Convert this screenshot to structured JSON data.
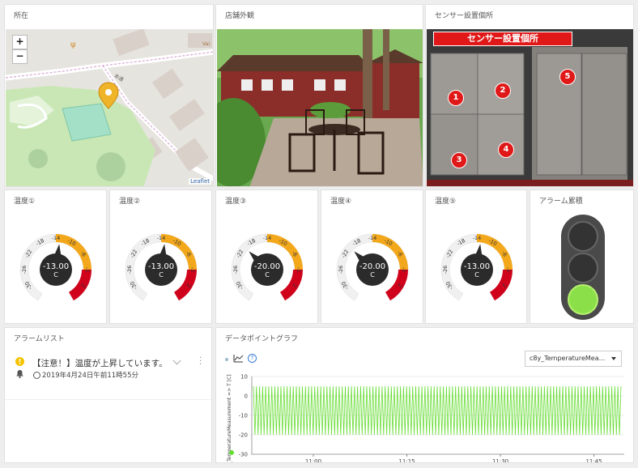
{
  "map": {
    "title": "所在",
    "zoom_in": "+",
    "zoom_out": "−",
    "street_label": "本通",
    "edge_label": "Vai",
    "attribution": "Leaflet"
  },
  "store": {
    "title": "店舗外観"
  },
  "sensor": {
    "title": "センサー設置個所",
    "banner": "センサー設置個所",
    "markers": [
      "1",
      "2",
      "3",
      "4",
      "5"
    ]
  },
  "gauges": [
    {
      "title": "温度①",
      "value": "-13.00",
      "unit": "C",
      "reading": -13
    },
    {
      "title": "温度②",
      "value": "-13.00",
      "unit": "C",
      "reading": -13
    },
    {
      "title": "温度③",
      "value": "-20.00",
      "unit": "C",
      "reading": -20
    },
    {
      "title": "温度④",
      "value": "-20.00",
      "unit": "C",
      "reading": -20
    },
    {
      "title": "温度⑤",
      "value": "-13.00",
      "unit": "C",
      "reading": -13
    }
  ],
  "gauge_ticks": [
    "-30",
    "-26",
    "-22",
    "-18",
    "-14",
    "-10",
    "-6",
    "-2",
    "2"
  ],
  "gauge_colors": {
    "green": "#ffffff",
    "yellow": "#f3a81c",
    "red": "#d0021b",
    "dial": "#2b2b2b"
  },
  "alarm_light": {
    "title": "アラーム累積",
    "active": "green"
  },
  "alarm_list": {
    "title": "アラームリスト",
    "items": [
      {
        "message": "【注意！】温度が上昇しています。",
        "time": "2019年4月24日午前11時55分"
      }
    ]
  },
  "datapoint": {
    "title": "データポイントグラフ",
    "select_value": "c8y_TemperatureMea...",
    "ylabel": "c8y_TemperatureMeasurement => T [C]"
  },
  "chart_data": {
    "type": "line",
    "xlabel": "",
    "ylabel": "c8y_TemperatureMeasurement => T [C]",
    "ylim": [
      -30,
      10
    ],
    "yticks": [
      10,
      0,
      -10,
      -20,
      -30
    ],
    "xticks": [
      "11:00",
      "11:15",
      "11:30",
      "11:45"
    ],
    "series": [
      {
        "color": "#66dd33",
        "min": -20,
        "max": 5,
        "pattern": "oscillating",
        "cycles": 120
      }
    ]
  }
}
